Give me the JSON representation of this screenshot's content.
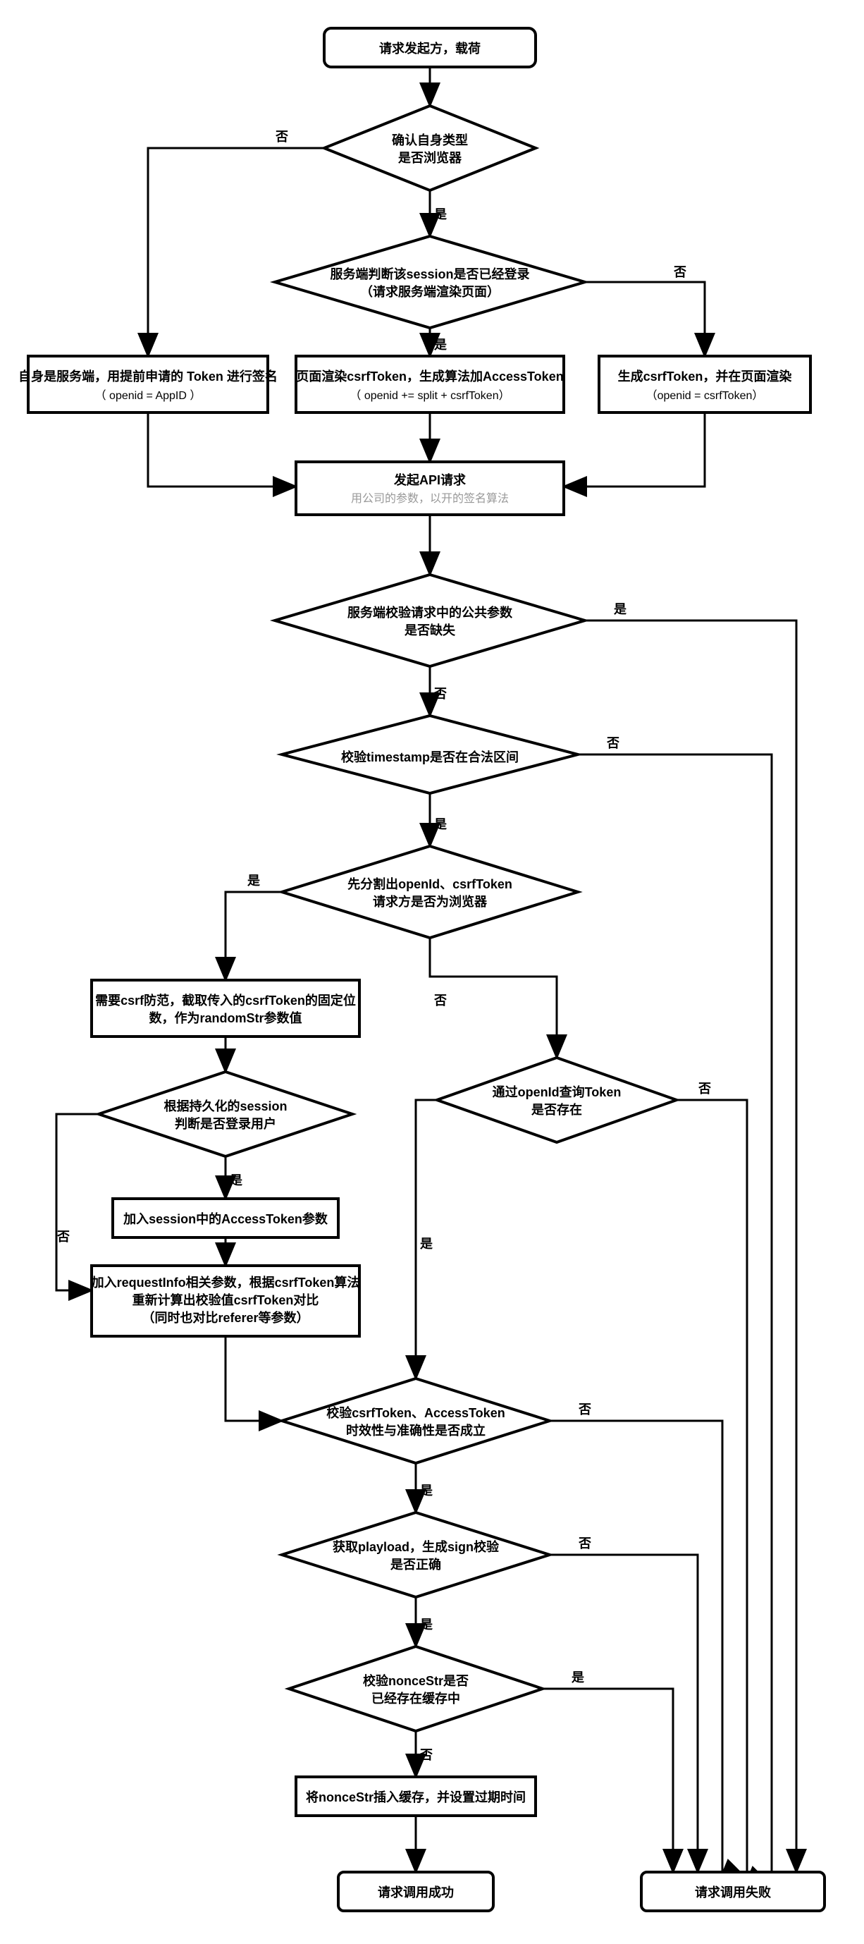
{
  "labels": {
    "yes": "是",
    "no": "否"
  },
  "nodes": {
    "start": {
      "line1": "请求发起方，载荷"
    },
    "d1": {
      "line1": "确认自身类型",
      "line2": "是否浏览器"
    },
    "d2": {
      "line1": "服务端判断该session是否已经登录",
      "line2": "（请求服务端渲染页面）"
    },
    "p_left": {
      "line1": "自身是服务端，用提前申请的 Token 进行签名",
      "line2": "（ openid = AppID ）"
    },
    "p_mid": {
      "line1": "页面渲染csrfToken，生成算法加AccessToken",
      "line2": "（ openid += split + csrfToken）"
    },
    "p_right": {
      "line1": "生成csrfToken，并在页面渲染",
      "line2": "（openid = csrfToken）"
    },
    "api": {
      "line1": "发起API请求",
      "line2": "用公司的参数，以开的签名算法"
    },
    "d3": {
      "line1": "服务端校验请求中的公共参数",
      "line2": "是否缺失"
    },
    "d4": {
      "line1": "校验timestamp是否在合法区间"
    },
    "d5": {
      "line1": "先分割出openId、csrfToken",
      "line2": "请求方是否为浏览器"
    },
    "p_csrf": {
      "line1": "需要csrf防范，截取传入的csrfToken的固定位",
      "line2": "数，作为randomStr参数值"
    },
    "d6": {
      "line1": "根据持久化的session",
      "line2": "判断是否登录用户"
    },
    "p_sess": {
      "line1": "加入session中的AccessToken参数"
    },
    "p_req": {
      "line1": "加入requestInfo相关参数，根据csrfToken算法",
      "line2": "重新计算出校验值csrfToken对比",
      "line3": "（同时也对比referer等参数）"
    },
    "d7": {
      "line1": "通过openId查询Token",
      "line2": "是否存在"
    },
    "d8": {
      "line1": "校验csrfToken、AccessToken",
      "line2": "时效性与准确性是否成立"
    },
    "d9": {
      "line1": "获取playload，生成sign校验",
      "line2": "是否正确"
    },
    "d10": {
      "line1": "校验nonceStr是否",
      "line2": "已经存在缓存中"
    },
    "p_cache": {
      "line1": "将nonceStr插入缓存，并设置过期时间"
    },
    "ok": {
      "line1": "请求调用成功"
    },
    "fail": {
      "line1": "请求调用失败"
    }
  },
  "chart_data": {
    "type": "flowchart",
    "title": "API请求签名校验流程",
    "nodes": [
      {
        "id": "start",
        "type": "terminator",
        "label": "请求发起方，载荷"
      },
      {
        "id": "d1",
        "type": "decision",
        "label": "确认自身类型是否浏览器"
      },
      {
        "id": "d2",
        "type": "decision",
        "label": "服务端判断该session是否已经登录（请求服务端渲染页面）"
      },
      {
        "id": "p_left",
        "type": "process",
        "label": "自身是服务端，用提前申请的 Token 进行签名（openid = AppID）"
      },
      {
        "id": "p_mid",
        "type": "process",
        "label": "页面渲染csrfToken，生成算法加AccessToken（openid += split + csrfToken）"
      },
      {
        "id": "p_right",
        "type": "process",
        "label": "生成csrfToken，并在页面渲染（openid = csrfToken）"
      },
      {
        "id": "api",
        "type": "process",
        "label": "发起API请求（用公司的参数，以开的签名算法）"
      },
      {
        "id": "d3",
        "type": "decision",
        "label": "服务端校验请求中的公共参数是否缺失"
      },
      {
        "id": "d4",
        "type": "decision",
        "label": "校验timestamp是否在合法区间"
      },
      {
        "id": "d5",
        "type": "decision",
        "label": "先分割出openId、csrfToken 请求方是否为浏览器"
      },
      {
        "id": "p_csrf",
        "type": "process",
        "label": "需要csrf防范，截取传入的csrfToken的固定位数，作为randomStr参数值"
      },
      {
        "id": "d6",
        "type": "decision",
        "label": "根据持久化的session判断是否登录用户"
      },
      {
        "id": "p_sess",
        "type": "process",
        "label": "加入session中的AccessToken参数"
      },
      {
        "id": "p_req",
        "type": "process",
        "label": "加入requestInfo相关参数，根据csrfToken算法重新计算出校验值csrfToken对比（同时也对比referer等参数）"
      },
      {
        "id": "d7",
        "type": "decision",
        "label": "通过openId查询Token是否存在"
      },
      {
        "id": "d8",
        "type": "decision",
        "label": "校验csrfToken、AccessToken时效性与准确性是否成立"
      },
      {
        "id": "d9",
        "type": "decision",
        "label": "获取playload，生成sign校验是否正确"
      },
      {
        "id": "d10",
        "type": "decision",
        "label": "校验nonceStr是否已经存在缓存中"
      },
      {
        "id": "p_cache",
        "type": "process",
        "label": "将nonceStr插入缓存，并设置过期时间"
      },
      {
        "id": "ok",
        "type": "terminator",
        "label": "请求调用成功"
      },
      {
        "id": "fail",
        "type": "terminator",
        "label": "请求调用失败"
      }
    ],
    "edges": [
      {
        "from": "start",
        "to": "d1",
        "label": ""
      },
      {
        "from": "d1",
        "to": "p_left",
        "label": "否"
      },
      {
        "from": "d1",
        "to": "d2",
        "label": "是"
      },
      {
        "from": "d2",
        "to": "p_mid",
        "label": "是"
      },
      {
        "from": "d2",
        "to": "p_right",
        "label": "否"
      },
      {
        "from": "p_left",
        "to": "api",
        "label": ""
      },
      {
        "from": "p_mid",
        "to": "api",
        "label": ""
      },
      {
        "from": "p_right",
        "to": "api",
        "label": ""
      },
      {
        "from": "api",
        "to": "d3",
        "label": ""
      },
      {
        "from": "d3",
        "to": "fail",
        "label": "是"
      },
      {
        "from": "d3",
        "to": "d4",
        "label": "否"
      },
      {
        "from": "d4",
        "to": "d5",
        "label": "是"
      },
      {
        "from": "d4",
        "to": "fail",
        "label": "否"
      },
      {
        "from": "d5",
        "to": "p_csrf",
        "label": "是"
      },
      {
        "from": "d5",
        "to": "d7",
        "label": "否"
      },
      {
        "from": "p_csrf",
        "to": "d6",
        "label": ""
      },
      {
        "from": "d6",
        "to": "p_sess",
        "label": "是"
      },
      {
        "from": "d6",
        "to": "p_req",
        "label": "否"
      },
      {
        "from": "p_sess",
        "to": "p_req",
        "label": ""
      },
      {
        "from": "p_req",
        "to": "d8",
        "label": ""
      },
      {
        "from": "d7",
        "to": "d8",
        "label": "是"
      },
      {
        "from": "d7",
        "to": "fail",
        "label": "否"
      },
      {
        "from": "d8",
        "to": "d9",
        "label": "是"
      },
      {
        "from": "d8",
        "to": "fail",
        "label": "否"
      },
      {
        "from": "d9",
        "to": "d10",
        "label": "是"
      },
      {
        "from": "d9",
        "to": "fail",
        "label": "否"
      },
      {
        "from": "d10",
        "to": "p_cache",
        "label": "否"
      },
      {
        "from": "d10",
        "to": "fail",
        "label": "是"
      },
      {
        "from": "p_cache",
        "to": "ok",
        "label": ""
      }
    ]
  }
}
